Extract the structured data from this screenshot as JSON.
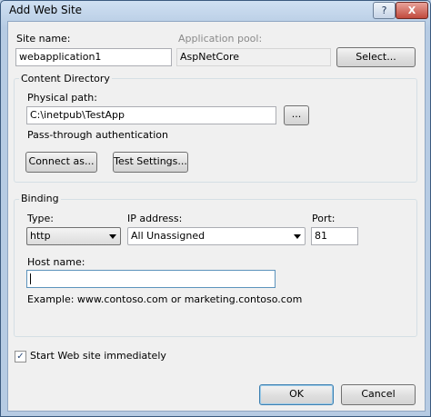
{
  "window": {
    "title": "Add Web Site",
    "help_label": "?",
    "close_label": "X"
  },
  "site": {
    "name_label": "Site name:",
    "name_value": "webapplication1",
    "pool_label": "Application pool:",
    "pool_value": "AspNetCore",
    "select_button": "Select..."
  },
  "content_directory": {
    "title": "Content Directory",
    "physical_path_label": "Physical path:",
    "physical_path_value": "C:\\inetpub\\TestApp",
    "browse_button": "...",
    "auth_text": "Pass-through authentication",
    "connect_as_button": "Connect as...",
    "test_settings_button": "Test Settings..."
  },
  "binding": {
    "title": "Binding",
    "type_label": "Type:",
    "type_value": "http",
    "ip_label": "IP address:",
    "ip_value": "All Unassigned",
    "port_label": "Port:",
    "port_value": "81",
    "host_label": "Host name:",
    "host_value": "",
    "example_text": "Example: www.contoso.com or marketing.contoso.com"
  },
  "start_immediately": {
    "label": "Start Web site immediately",
    "checked": true,
    "check_glyph": "✓"
  },
  "footer": {
    "ok_button": "OK",
    "cancel_button": "Cancel"
  }
}
